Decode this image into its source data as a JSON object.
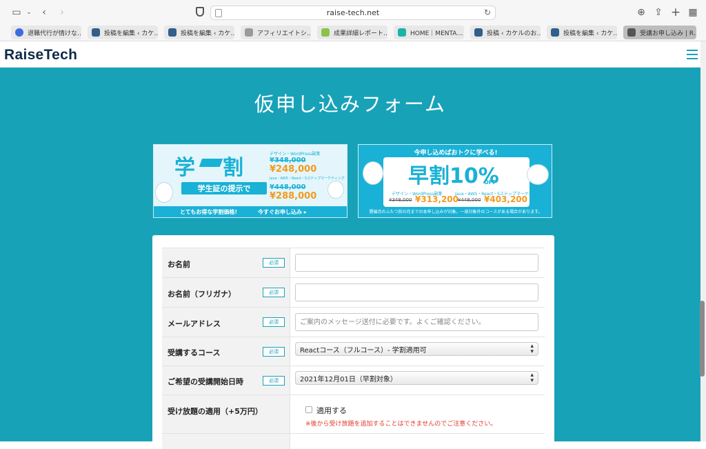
{
  "browser": {
    "url": "raise-tech.net",
    "tabs": [
      {
        "label": "退職代行が情けな…",
        "color": "#3d6be0"
      },
      {
        "label": "投稿を編集 ‹ カケ…",
        "color": "#2f5f8a"
      },
      {
        "label": "投稿を編集 ‹ カケ…",
        "color": "#2f5f8a"
      },
      {
        "label": "アフィリエイトシ…",
        "color": "#9a9a9a"
      },
      {
        "label": "成果詳細レポート…",
        "color": "#8bc34a"
      },
      {
        "label": "HOME｜MENTA…",
        "color": "#19b3a8"
      },
      {
        "label": "投稿 ‹ カケルのお…",
        "color": "#2f5f8a"
      },
      {
        "label": "投稿を編集 ‹ カケ…",
        "color": "#2f5f8a"
      },
      {
        "label": "受講お申し込み | R…",
        "color": "#555555"
      }
    ]
  },
  "site": {
    "logo": "RaiseTech",
    "accent": "#18a2b8"
  },
  "page": {
    "title": "仮申し込みフォーム"
  },
  "banners": {
    "student": {
      "title": "学割",
      "price_label_1": "デザイン・WordPress副業",
      "old_1": "¥348,000",
      "new_1": "¥248,000",
      "price_label_2": "Java・AWS・React・Sステップマーケティング",
      "old_2": "¥448,000",
      "new_2": "¥288,000",
      "subtitle": "学生証の提示で",
      "footer": "とてもお得な学割価格!",
      "cta": "今すぐお申し込み ▸"
    },
    "early": {
      "headline": "今申し込めばおトクに学べる!",
      "title": "早割10%",
      "off": "OFF",
      "course_1": "デザイン・WordPress副業",
      "course_2": "Java・AWS・React・Sステップマーケティング",
      "old_1": "¥348,000",
      "new_1": "¥313,200",
      "old_2": "¥448,000",
      "new_2": "¥403,200",
      "note": "開催月のふたつ前の月までの本申し込みが対象。一部対象外のコースがある場合があります。"
    }
  },
  "form": {
    "required_label": "必須",
    "rows": [
      {
        "label": "お名前",
        "value": "",
        "placeholder": ""
      },
      {
        "label": "お名前（フリガナ）",
        "value": "",
        "placeholder": ""
      },
      {
        "label": "メールアドレス",
        "value": "",
        "placeholder": "ご案内のメッセージ送付に必要です。よくご確認ください。"
      },
      {
        "label": "受講するコース",
        "value": "Reactコース（フルコース）- 学割適用可"
      },
      {
        "label": "ご希望の受講開始日時",
        "value": "2021年12月01日（早割対象）"
      },
      {
        "label": "受け放題の適用（+5万円）",
        "checkbox_label": "適用する",
        "note": "※後から受け放題を追加することはできませんのでご注意ください。"
      }
    ]
  }
}
